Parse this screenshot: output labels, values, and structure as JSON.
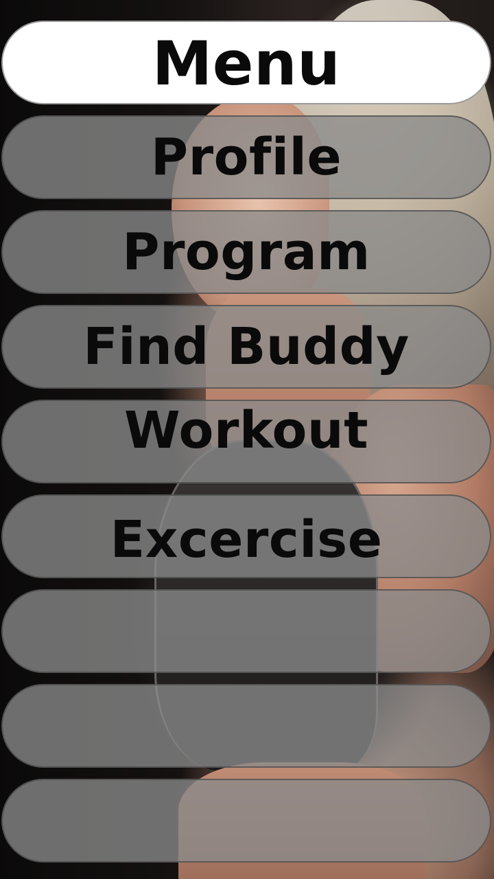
{
  "menu": {
    "title": "Menu",
    "items": [
      {
        "label": "Profile"
      },
      {
        "label": "Program"
      },
      {
        "label": "Find Buddy"
      },
      {
        "label": "Workout"
      },
      {
        "label": "Excercise"
      },
      {
        "label": ""
      },
      {
        "label": ""
      },
      {
        "label": ""
      }
    ]
  },
  "background": {
    "description_icon": "athlete-photo"
  },
  "colors": {
    "header_bg": "#ffffff",
    "item_bg": "#8a8a8a",
    "text": "#0a0a0a"
  }
}
